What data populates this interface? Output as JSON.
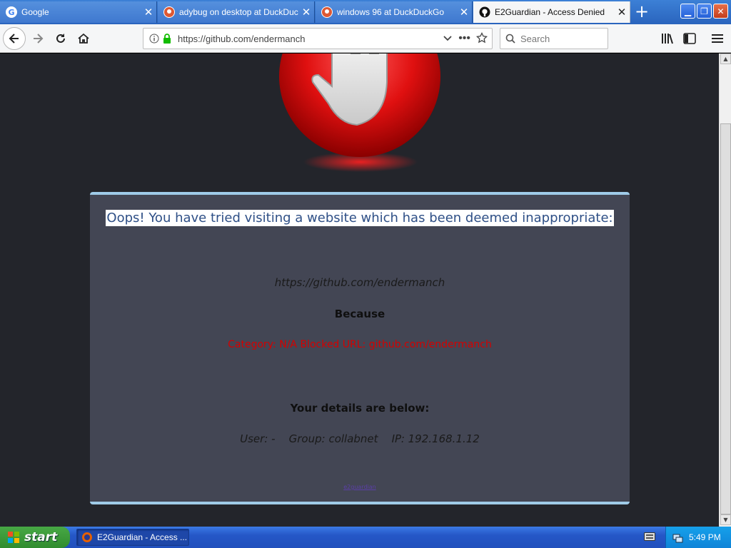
{
  "browser": {
    "tabs": [
      {
        "title": "Google",
        "favicon": "google-g-icon",
        "active": false
      },
      {
        "title": "adybug on desktop at DuckDuckG",
        "favicon": "duckduckgo-icon",
        "active": false
      },
      {
        "title": "windows 96 at DuckDuckGo",
        "favicon": "duckduckgo-icon",
        "active": false
      },
      {
        "title": "E2Guardian - Access Denied",
        "favicon": "github-icon",
        "active": true
      }
    ],
    "new_tab_label": "+",
    "url": "https://github.com/endermanch",
    "search_placeholder": "Search"
  },
  "page": {
    "headline": "Oops! You have tried visiting a website which has been deemed inappropriate:",
    "blocked_url": "https://github.com/endermanch",
    "because_label": "Because",
    "reason": "Category: N/A   Blocked URL: github.com/endermanch",
    "details_heading": "Your details are below:",
    "details": "User: -    Group: collabnet    IP: 192.168.1.12",
    "small_link": "e2guardian",
    "colors": {
      "background": "#23252b",
      "panel": "#434654",
      "panel_border": "#9fcbe8",
      "headline_text": "#2e4f86",
      "reason_text": "#d40000"
    }
  },
  "taskbar": {
    "start_label": "start",
    "task_label": "E2Guardian - Access ...",
    "clock": "5:49 PM"
  }
}
